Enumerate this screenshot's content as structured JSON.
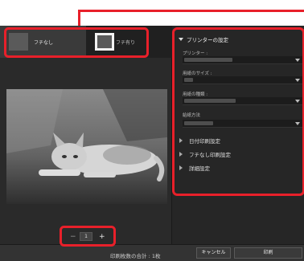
{
  "accent_color": "#e8202a",
  "border_options": [
    {
      "label": "フチなし",
      "selected": true
    },
    {
      "label": "フチ有り",
      "selected": false
    }
  ],
  "pager": {
    "prev": "−",
    "page": "1",
    "next": "+"
  },
  "printer_settings": {
    "header": "プリンターの設定",
    "fields": [
      {
        "label": "プリンター :"
      },
      {
        "label": "用紙のサイズ :"
      },
      {
        "label": "用紙の種類 :"
      },
      {
        "label": "給紙方法"
      }
    ],
    "collapsed_sections": [
      "日付印刷設定",
      "フチなし印刷設定",
      "詳細設定"
    ]
  },
  "footer": {
    "total_text": "印刷枚数の合計 : 1枚",
    "cancel_label": "キャンセル",
    "print_label": "印刷"
  }
}
